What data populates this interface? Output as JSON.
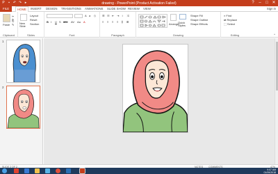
{
  "window": {
    "title": "drawing - PowerPoint (Product Activation Failed)",
    "controls": [
      "?",
      "–",
      "□",
      "✕"
    ]
  },
  "tabs": [
    {
      "label": "FILE"
    },
    {
      "label": "HOME"
    },
    {
      "label": "INSERT"
    },
    {
      "label": "DESIGN"
    },
    {
      "label": "TRANSITIONS"
    },
    {
      "label": "ANIMATIONS"
    },
    {
      "label": "SLIDE SHOW"
    },
    {
      "label": "REVIEW"
    },
    {
      "label": "VIEW"
    }
  ],
  "active_tab": "HOME",
  "sign_in": "Sign in",
  "ribbon": {
    "clipboard": {
      "paste": "Paste",
      "label": "Clipboard"
    },
    "slides": {
      "new_slide": "New Slide",
      "layout": "Layout",
      "reset": "Reset",
      "section": "Section",
      "label": "Slides"
    },
    "font": {
      "label": "Font"
    },
    "paragraph": {
      "label": "Paragraph"
    },
    "drawing": {
      "arrange": "Arrange",
      "quick_styles": "Quick Styles",
      "shape_fill": "Shape Fill",
      "shape_outline": "Shape Outline",
      "shape_effects": "Shape Effects",
      "label": "Drawing"
    },
    "editing": {
      "find": "Find",
      "replace": "Replace",
      "select": "Select",
      "label": "Editing"
    }
  },
  "slides_panel": [
    {
      "number": "1"
    },
    {
      "number": "2"
    }
  ],
  "status": {
    "slide_info": "SLIDE 2 OF 2",
    "notes": "NOTES",
    "comments": "COMMENTS",
    "zoom": "47%"
  },
  "taskbar": {
    "time": "9:07 AM",
    "date": "01/09/2018"
  },
  "colors": {
    "accent": "#c43e1c",
    "hijab_blue": "#4a8fd0",
    "hijab_pink": "#f18a86",
    "shirt_green": "#92c47d",
    "skin": "#fce7d6",
    "taskbar": "#1f3a5c"
  }
}
